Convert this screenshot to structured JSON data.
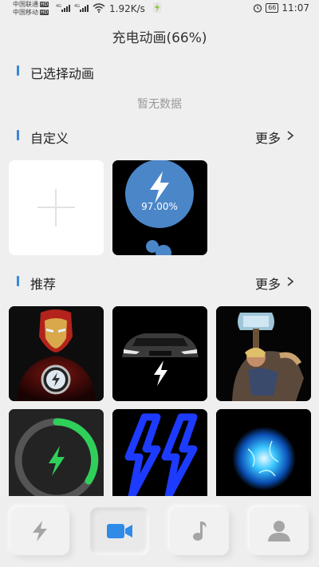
{
  "status_bar": {
    "carrier1": "中国联通",
    "carrier2": "中国移动",
    "hd": "HD",
    "net": "4G",
    "speed": "1.92K/s",
    "battery": "66",
    "time": "11:07"
  },
  "page": {
    "title": "充电动画(66%)"
  },
  "selected": {
    "heading": "已选择动画",
    "empty_text": "暂无数据"
  },
  "custom": {
    "heading": "自定义",
    "more": "更多",
    "percent": "97.00%",
    "accent": "#4a86c8"
  },
  "recommend": {
    "heading": "推荐",
    "more": "更多",
    "items": [
      {
        "icon": "iron-man-icon"
      },
      {
        "icon": "car-charging-icon"
      },
      {
        "icon": "thor-hammer-icon"
      },
      {
        "icon": "green-ring-bolt-icon"
      },
      {
        "icon": "blue-neon-bolt-icon"
      },
      {
        "icon": "plasma-orb-icon"
      }
    ]
  },
  "tabs": [
    {
      "icon": "bolt-icon",
      "active": false
    },
    {
      "icon": "video-icon",
      "active": true
    },
    {
      "icon": "music-note-icon",
      "active": false
    },
    {
      "icon": "user-icon",
      "active": false
    }
  ],
  "colors": {
    "accent_blue": "#3b86d8",
    "active_tab_icon": "#2f8be6",
    "inactive_tab_icon": "#a5a5a5"
  }
}
